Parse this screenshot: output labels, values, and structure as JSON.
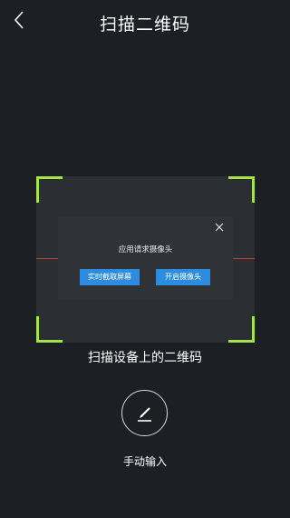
{
  "header": {
    "title": "扫描二维码",
    "back_icon": "chevron-left-icon"
  },
  "scanner": {
    "corner_color": "#a8e24a",
    "scan_line_color": "#c0392b",
    "caption": "扫描设备上的二维码"
  },
  "dialog": {
    "message": "应用请求摄像头",
    "close_icon": "close-icon",
    "buttons": {
      "screenshot_label": "实时截取屏幕",
      "camera_label": "开启摄像头"
    },
    "button_color": "#2e8ce0"
  },
  "manual": {
    "icon": "pencil-icon",
    "label": "手动输入"
  }
}
